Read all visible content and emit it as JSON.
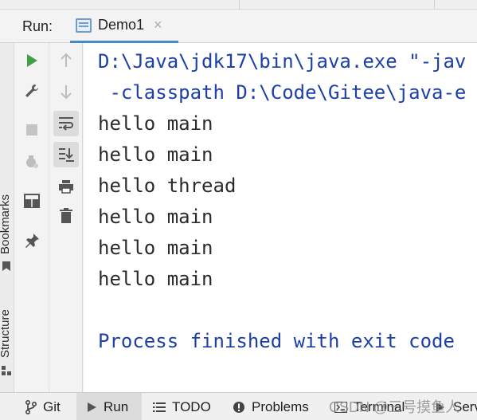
{
  "run_panel": {
    "label": "Run:",
    "tab_title": "Demo1",
    "tab_close": "×"
  },
  "side_strip": {
    "bookmarks": "Bookmarks",
    "structure": "Structure"
  },
  "toolbar_icons": {
    "col1": [
      "run-icon",
      "wrench-icon",
      "stop-icon",
      "debug-icon",
      "layout-icon",
      "pin-icon"
    ],
    "col2": [
      "arrow-up-icon",
      "arrow-down-icon",
      "soft-wrap-icon",
      "scroll-to-end-icon",
      "print-icon",
      "trash-icon"
    ]
  },
  "console": {
    "lines": [
      {
        "kind": "cmd",
        "text": "D:\\Java\\jdk17\\bin\\java.exe \"-jav"
      },
      {
        "kind": "cmd",
        "text": " -classpath D:\\Code\\Gitee\\java-e"
      },
      {
        "kind": "out",
        "text": "hello main"
      },
      {
        "kind": "out",
        "text": "hello main"
      },
      {
        "kind": "out",
        "text": "hello thread"
      },
      {
        "kind": "out",
        "text": "hello main"
      },
      {
        "kind": "out",
        "text": "hello main"
      },
      {
        "kind": "out",
        "text": "hello main"
      },
      {
        "kind": "blank",
        "text": ""
      },
      {
        "kind": "fin",
        "text": "Process finished with exit code"
      }
    ]
  },
  "bottom_bar": {
    "git": "Git",
    "run": "Run",
    "todo": "TODO",
    "problems": "Problems",
    "terminal": "Terminal",
    "services": "Serv"
  },
  "watermark": "CSDN @三号摸鱼人",
  "colors": {
    "console_command": "#1c3fa8",
    "console_output": "#2b2b2b",
    "run_green": "#3f9f46",
    "tab_underline": "#4a88c7"
  }
}
